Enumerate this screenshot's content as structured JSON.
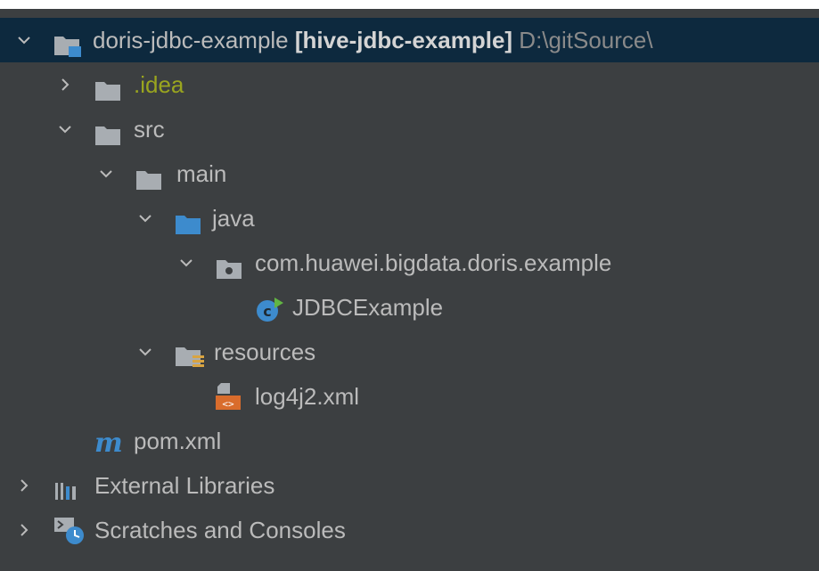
{
  "tree": {
    "project": {
      "name": "doris-jdbc-example",
      "module": "[hive-jdbc-example]",
      "path": "D:\\gitSource\\"
    },
    "idea": ".idea",
    "src": "src",
    "main": "main",
    "java": "java",
    "package": "com.huawei.bigdata.doris.example",
    "class": "JDBCExample",
    "resources": "resources",
    "log_file": "log4j2.xml",
    "pom": "pom.xml",
    "external_libraries": "External Libraries",
    "scratches": "Scratches and Consoles"
  },
  "colors": {
    "background": "#3c3f41",
    "selection": "#0d293e",
    "folder": "#a8adb2",
    "source_folder": "#3d8bcd",
    "idea_text": "#9aa51f"
  }
}
